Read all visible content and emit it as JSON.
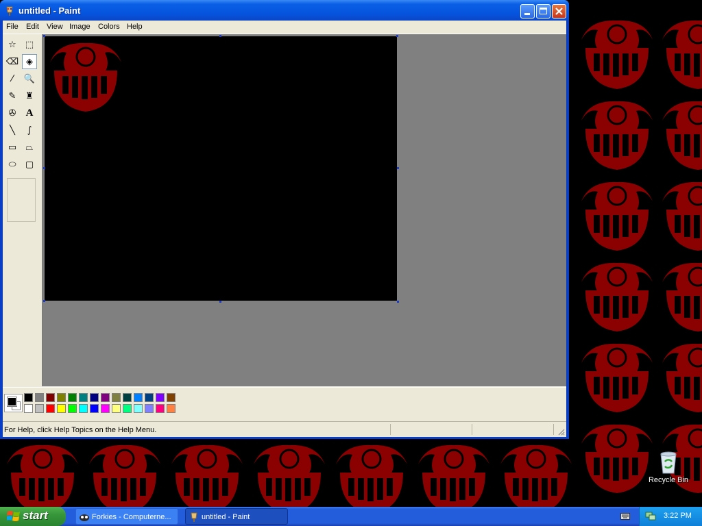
{
  "window": {
    "title": "untitled - Paint",
    "buttons": {
      "minimize": "_",
      "maximize": "□",
      "close": "✕"
    }
  },
  "menu": [
    "File",
    "Edit",
    "View",
    "Image",
    "Colors",
    "Help"
  ],
  "tools": [
    {
      "name": "free-form-select-icon",
      "glyph": "☆"
    },
    {
      "name": "select-icon",
      "glyph": "⬚"
    },
    {
      "name": "eraser-icon",
      "glyph": "⌫"
    },
    {
      "name": "fill-with-color-icon",
      "glyph": "◈",
      "selected": true
    },
    {
      "name": "pick-color-icon",
      "glyph": "⁄"
    },
    {
      "name": "magnifier-icon",
      "glyph": "🔍"
    },
    {
      "name": "pencil-icon",
      "glyph": "✎"
    },
    {
      "name": "brush-icon",
      "glyph": "♜"
    },
    {
      "name": "airbrush-icon",
      "glyph": "✇"
    },
    {
      "name": "text-icon",
      "glyph": "A"
    },
    {
      "name": "line-icon",
      "glyph": "╲"
    },
    {
      "name": "curve-icon",
      "glyph": "∫"
    },
    {
      "name": "rectangle-icon",
      "glyph": "▭"
    },
    {
      "name": "polygon-icon",
      "glyph": "⏢"
    },
    {
      "name": "ellipse-icon",
      "glyph": "⬭"
    },
    {
      "name": "rounded-rectangle-icon",
      "glyph": "▢"
    }
  ],
  "palette": {
    "foreground": "#000000",
    "background": "#ffffff",
    "top_row": [
      "#000000",
      "#808080",
      "#800000",
      "#808000",
      "#008000",
      "#008080",
      "#000080",
      "#800080",
      "#808040",
      "#004040",
      "#0080ff",
      "#004080",
      "#8000ff",
      "#804000"
    ],
    "bottom_row": [
      "#ffffff",
      "#c0c0c0",
      "#ff0000",
      "#ffff00",
      "#00ff00",
      "#00ffff",
      "#0000ff",
      "#ff00ff",
      "#ffff80",
      "#00ff80",
      "#80ffff",
      "#8080ff",
      "#ff0080",
      "#ff8040"
    ]
  },
  "status": {
    "text": "For Help, click Help Topics on the Help Menu."
  },
  "desktop": {
    "recycle_bin_label": "Recycle Bin",
    "wallpaper_color": "#8b0000"
  },
  "taskbar": {
    "start_label": "start",
    "tasks": [
      {
        "label": "Forkies - Computerne...",
        "active": false
      },
      {
        "label": "untitled - Paint",
        "active": true
      }
    ],
    "clock": "3:22 PM"
  }
}
